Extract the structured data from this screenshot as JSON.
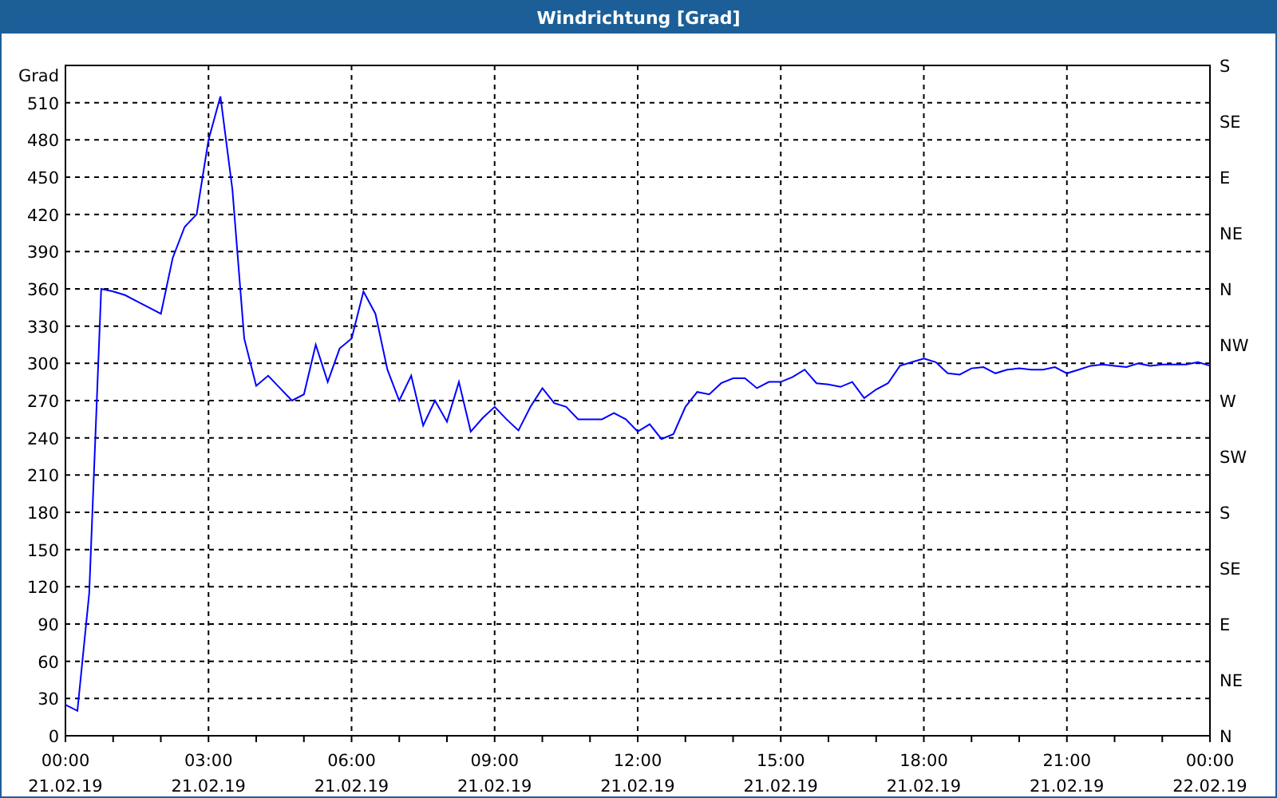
{
  "window": {
    "title": "Windrichtung [Grad]"
  },
  "chart": {
    "compass_labels": [
      "S",
      "SE",
      "E",
      "NE",
      "N",
      "NW",
      "W",
      "SW",
      "S",
      "SE",
      "E",
      "NE",
      "N"
    ],
    "chart_data": {
      "type": "line",
      "ylabel": "Grad",
      "ylim": [
        0,
        540
      ],
      "grid": true,
      "yticks": [
        0,
        30,
        60,
        90,
        120,
        150,
        180,
        210,
        240,
        270,
        300,
        330,
        360,
        390,
        420,
        450,
        480,
        510
      ],
      "categories": [
        "00:00 21.02.19",
        null,
        null,
        null,
        null,
        null,
        null,
        null,
        null,
        null,
        null,
        null,
        "03:00 21.02.19",
        null,
        null,
        null,
        null,
        null,
        null,
        null,
        null,
        null,
        null,
        null,
        "06:00 21.02.19",
        null,
        null,
        null,
        null,
        null,
        null,
        null,
        null,
        null,
        null,
        null,
        "09:00 21.02.19",
        null,
        null,
        null,
        null,
        null,
        null,
        null,
        null,
        null,
        null,
        null,
        "12:00 21.02.19",
        null,
        null,
        null,
        null,
        null,
        null,
        null,
        null,
        null,
        null,
        null,
        "15:00 21.02.19",
        null,
        null,
        null,
        null,
        null,
        null,
        null,
        null,
        null,
        null,
        null,
        "18:00 21.02.19",
        null,
        null,
        null,
        null,
        null,
        null,
        null,
        null,
        null,
        null,
        null,
        "21:00 21.02.19",
        null,
        null,
        null,
        null,
        null,
        null,
        null,
        null,
        null,
        null,
        null,
        "00:00 22.02.19"
      ],
      "series": [
        {
          "color": "#0000ff",
          "values": [
            25,
            20,
            115,
            360,
            358,
            355,
            350,
            345,
            340,
            385,
            410,
            420,
            480,
            515,
            440,
            320,
            282,
            290,
            280,
            270,
            275,
            315,
            285,
            312,
            320,
            358,
            340,
            295,
            270,
            290,
            250,
            270,
            253,
            285,
            245,
            256,
            265,
            255,
            246,
            265,
            280,
            268,
            265,
            255,
            255,
            255,
            260,
            255,
            245,
            251,
            239,
            243,
            265,
            277,
            275,
            284,
            288,
            288,
            280,
            285,
            285,
            289,
            295,
            284,
            283,
            281,
            285,
            272,
            279,
            284,
            298,
            301,
            304,
            301,
            292,
            291,
            296,
            297,
            292,
            295,
            296,
            295,
            295,
            297,
            292,
            295,
            298,
            299,
            298,
            297,
            300,
            298,
            299,
            299,
            299,
            301,
            298
          ]
        }
      ]
    }
  }
}
